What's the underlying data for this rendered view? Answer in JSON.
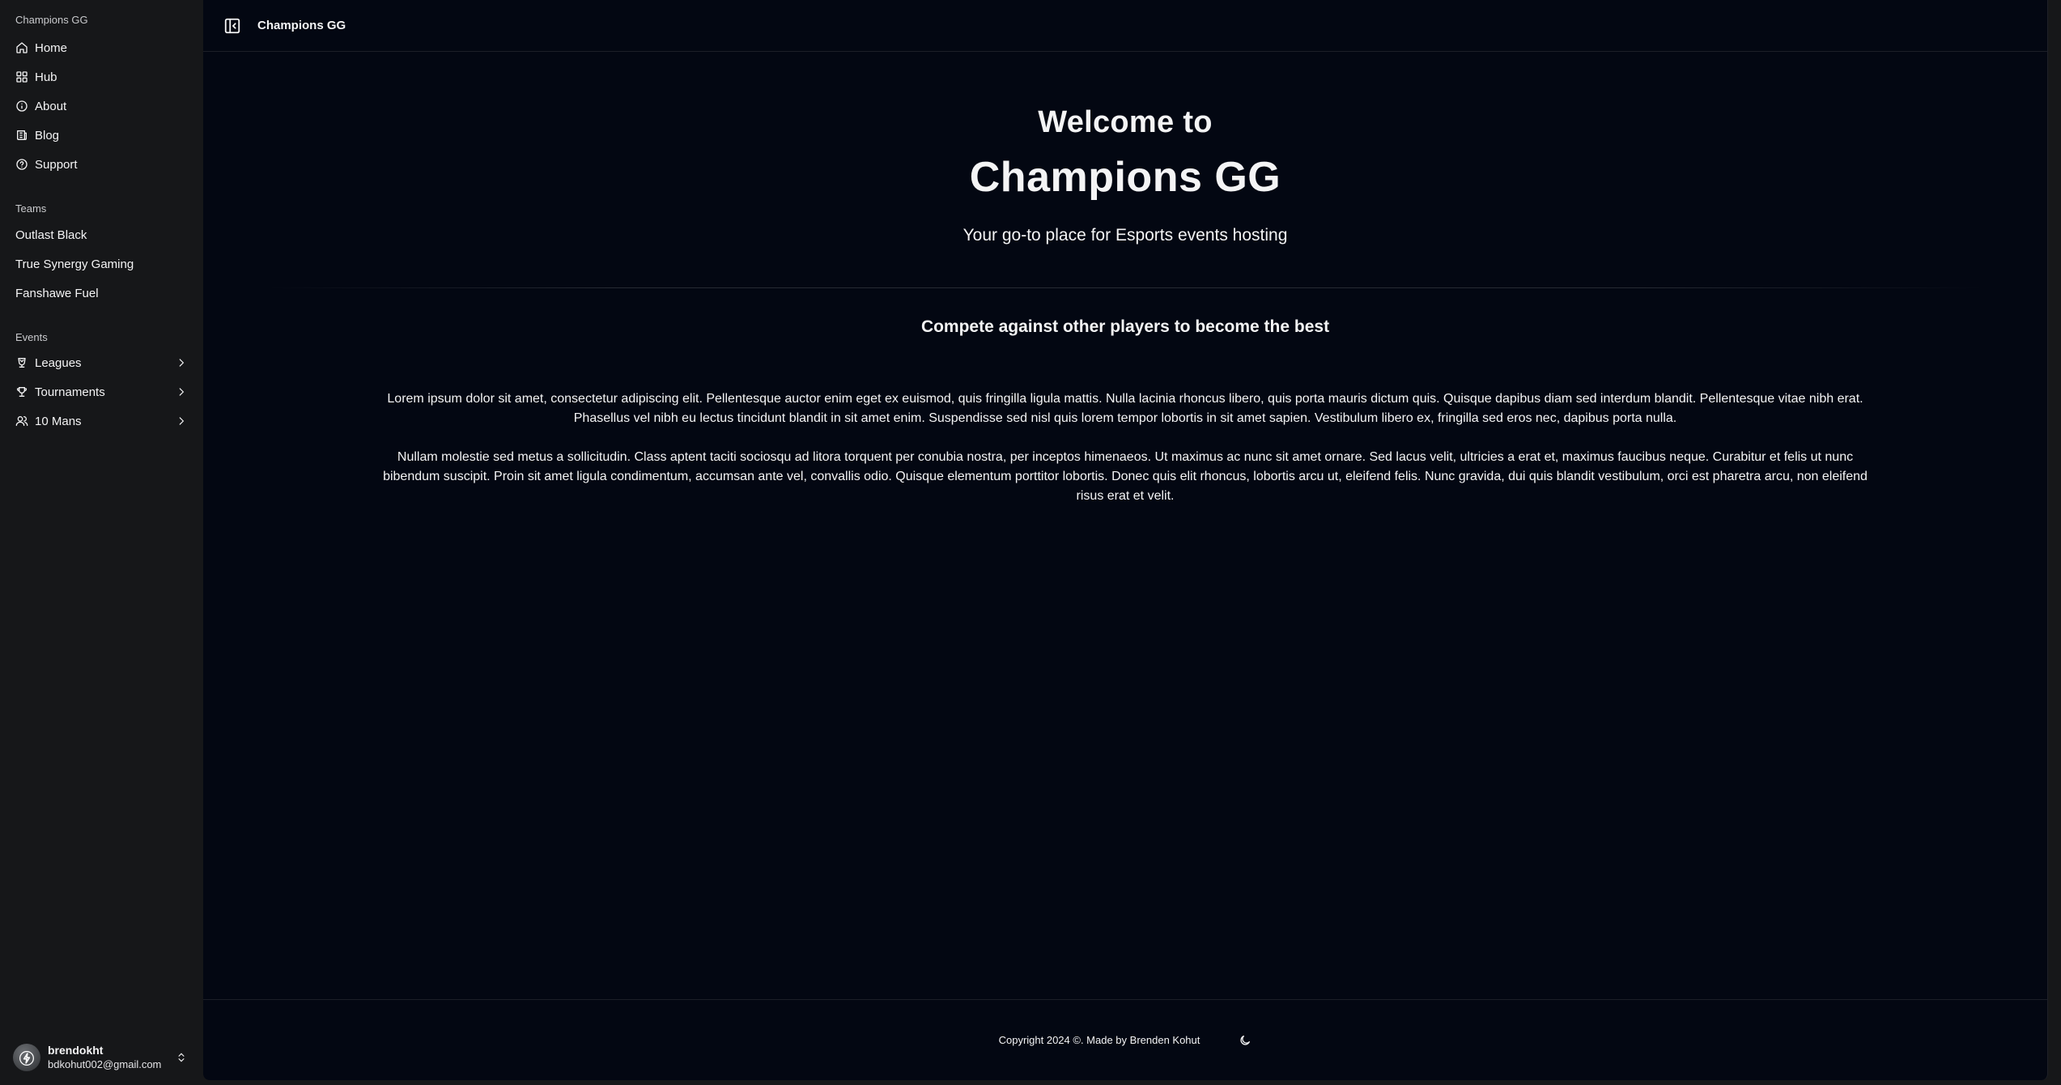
{
  "sidebar": {
    "brand": "Champions GG",
    "nav": [
      {
        "label": "Home",
        "icon": "home-icon"
      },
      {
        "label": "Hub",
        "icon": "grid-icon"
      },
      {
        "label": "About",
        "icon": "info-icon"
      },
      {
        "label": "Blog",
        "icon": "newspaper-icon"
      },
      {
        "label": "Support",
        "icon": "help-circle-icon"
      }
    ],
    "teams_label": "Teams",
    "teams": [
      "Outlast Black",
      "True Synergy Gaming",
      "Fanshawe Fuel"
    ],
    "events_label": "Events",
    "events": [
      {
        "label": "Leagues",
        "icon": "trophy-cup-icon"
      },
      {
        "label": "Tournaments",
        "icon": "trophy-icon"
      },
      {
        "label": "10 Mans",
        "icon": "users-icon"
      }
    ],
    "user": {
      "name": "brendokht",
      "email": "bdkohut002@gmail.com"
    }
  },
  "topbar": {
    "title": "Champions GG"
  },
  "hero": {
    "welcome": "Welcome to",
    "title": "Champions GG",
    "tagline": "Your go-to place for Esports events hosting"
  },
  "content": {
    "compete": "Compete against other players to become the best",
    "paragraph1": "Lorem ipsum dolor sit amet, consectetur adipiscing elit. Pellentesque auctor enim eget ex euismod, quis fringilla ligula mattis. Nulla lacinia rhoncus libero, quis porta mauris dictum quis. Quisque dapibus diam sed interdum blandit. Pellentesque vitae nibh erat. Phasellus vel nibh eu lectus tincidunt blandit in sit amet enim. Suspendisse sed nisl quis lorem tempor lobortis in sit amet sapien. Vestibulum libero ex, fringilla sed eros nec, dapibus porta nulla.",
    "paragraph2": "Nullam molestie sed metus a sollicitudin. Class aptent taciti sociosqu ad litora torquent per conubia nostra, per inceptos himenaeos. Ut maximus ac nunc sit amet ornare. Sed lacus velit, ultricies a erat et, maximus faucibus neque. Curabitur et felis ut nunc bibendum suscipit. Proin sit amet ligula condimentum, accumsan ante vel, convallis odio. Quisque elementum porttitor lobortis. Donec quis elit rhoncus, lobortis arcu ut, eleifend felis. Nunc gravida, dui quis blandit vestibulum, orci est pharetra arcu, non eleifend risus erat et velit."
  },
  "footer": {
    "copyright": "Copyright 2024 ©. Made by Brenden Kohut"
  },
  "colors": {
    "sidebar_bg": "#161719",
    "main_bg": "#030712",
    "text": "#f4f4f5"
  }
}
